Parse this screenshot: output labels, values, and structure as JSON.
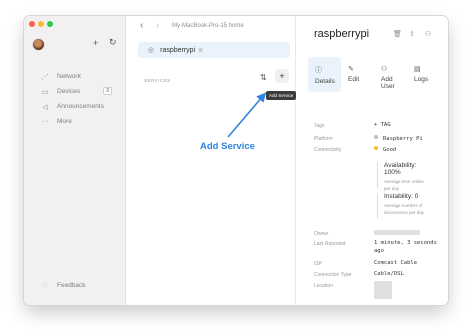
{
  "sidebar": {
    "add_icon": "+",
    "sync_icon": "↻",
    "items": [
      {
        "label": "Network",
        "icon": "network-icon",
        "glyph": "⋰"
      },
      {
        "label": "Devices",
        "icon": "devices-icon",
        "glyph": "▭",
        "badge": "3"
      },
      {
        "label": "Announcements",
        "icon": "megaphone-icon",
        "glyph": "◁"
      },
      {
        "label": "More",
        "icon": "more-icon",
        "glyph": "···"
      }
    ],
    "feedback": {
      "label": "Feedback",
      "glyph": "◌"
    }
  },
  "middle": {
    "back": "‹",
    "forward": "›",
    "path": "My-MacBook-Pro-15 home",
    "device": {
      "location_glyph": "◎",
      "name": "raspberrypi",
      "wifi_glyph": "≋"
    },
    "services_label": "SERVICES",
    "sort_glyph": "⇅",
    "add_glyph": "+",
    "tooltip": "Add Service",
    "callout": "Add Service",
    "accent": "#2f86de"
  },
  "detail": {
    "title": "raspberrypi",
    "tabs": [
      {
        "label": "Details",
        "glyph": "ⓘ",
        "active": true
      },
      {
        "label": "Edit",
        "glyph": "✎",
        "active": false
      },
      {
        "label": "Add User",
        "glyph": "⚇",
        "active": false
      },
      {
        "label": "Logs",
        "glyph": "▤",
        "active": false
      }
    ],
    "fields": {
      "tags_label": "Tags",
      "tags_value": "+ TAG",
      "platform_label": "Platform",
      "platform_value": "Raspberry Pi",
      "connectivity_label": "Connectivity",
      "connectivity_value": "Good",
      "availability": "Availability: 100%",
      "availability_note": "Average time online per day",
      "instability": "Instability: 0",
      "instability_note": "Average number of disconnects per day",
      "owner_label": "Owner",
      "last_reported_label": "Last Reported",
      "last_reported_value": "1 minute, 3 seconds ago",
      "isp_label": "ISP",
      "isp_value": "Comcast Cable",
      "connection_type_label": "Connection Type",
      "connection_type_value": "Cable/DSL",
      "location_label": "Location"
    }
  }
}
